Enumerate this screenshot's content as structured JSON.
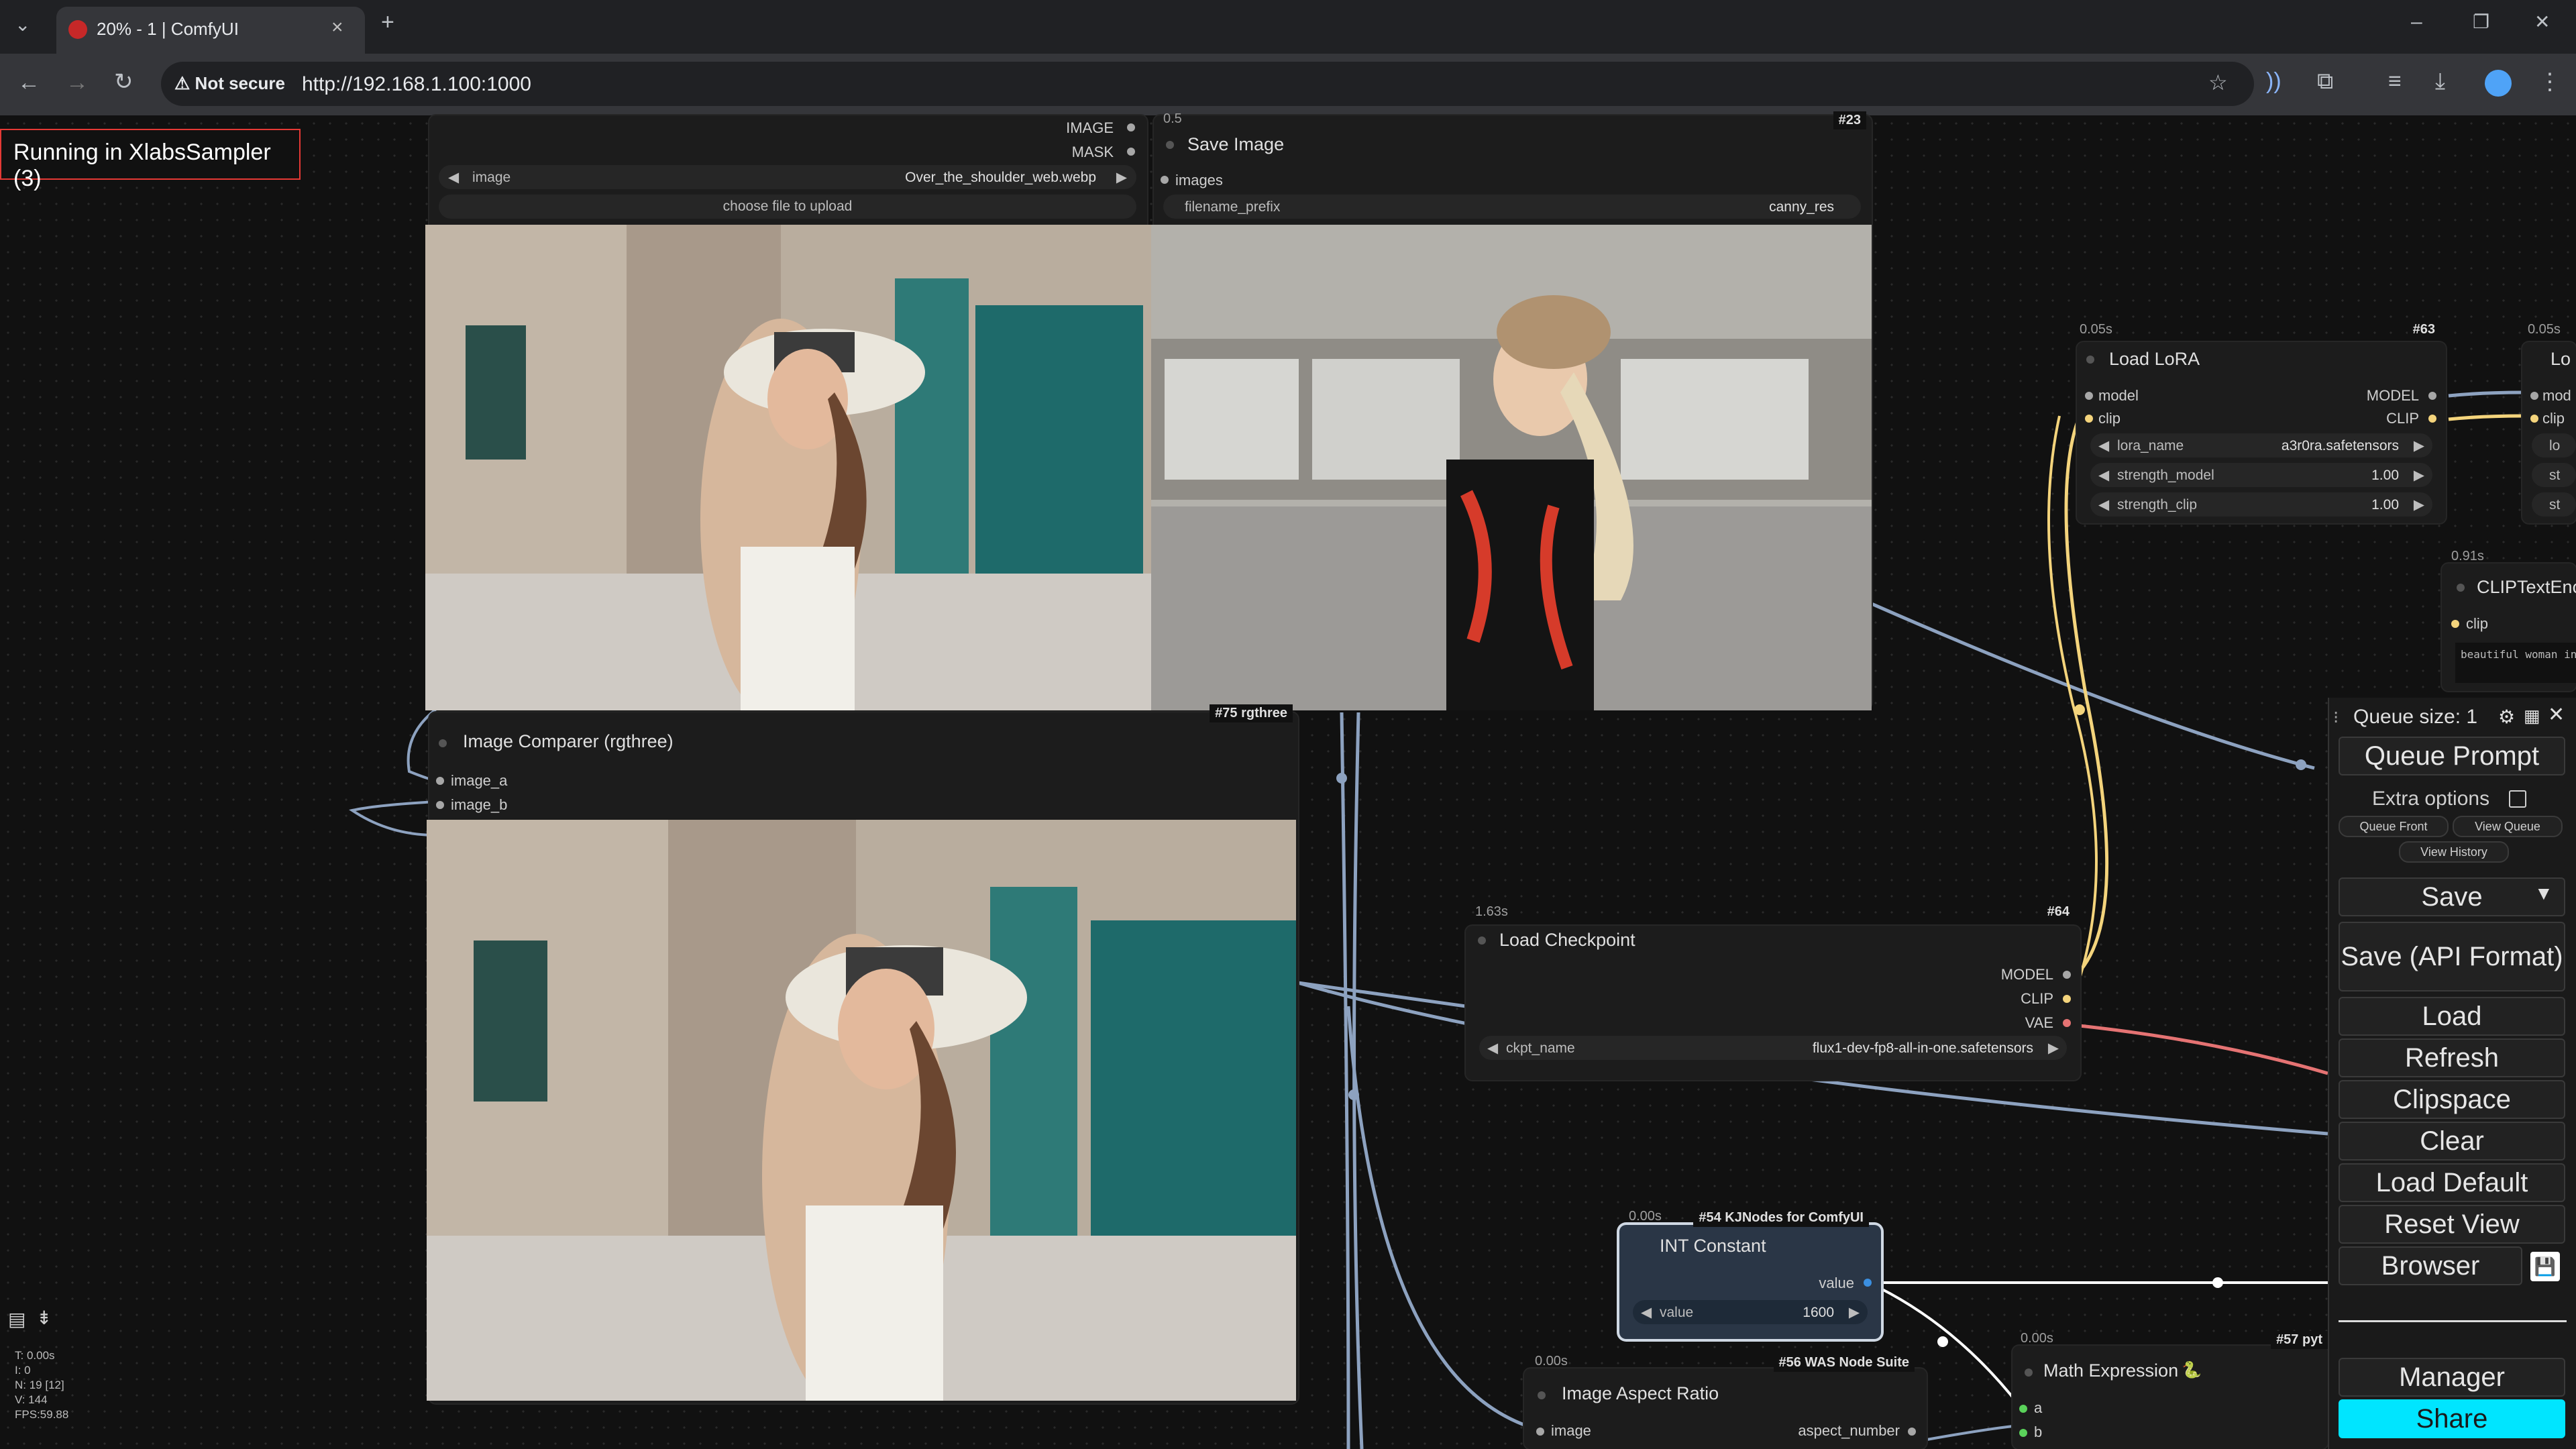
{
  "browser": {
    "tab_title": "20% - 1 | ComfyUI",
    "new_tab": "+",
    "security_label": "Not secure",
    "url": "http://192.168.1.100:1000",
    "window_controls": [
      "–",
      "❐",
      "✕"
    ]
  },
  "status": {
    "text": "Running in XlabsSampler (3)"
  },
  "load_image_node": {
    "outputs": [
      "IMAGE",
      "MASK"
    ],
    "widget_label": "image",
    "widget_value": "Over_the_shoulder_web.webp",
    "upload_label": "choose file to upload"
  },
  "save_image_node": {
    "timing": "0.5",
    "badge": "#23",
    "title": "Save Image",
    "input": "images",
    "widget_label": "filename_prefix",
    "widget_value": "canny_res"
  },
  "comparer_node": {
    "badge": "#75 rgthree",
    "title": "Image Comparer (rgthree)",
    "inputs": [
      "image_a",
      "image_b"
    ]
  },
  "lora_node": {
    "timing": "0.05s",
    "badge": "#63",
    "title": "Load LoRA",
    "inputs": [
      "model",
      "clip"
    ],
    "outputs": [
      "MODEL",
      "CLIP"
    ],
    "widgets": [
      {
        "label": "lora_name",
        "value": "a3r0ra.safetensors"
      },
      {
        "label": "strength_model",
        "value": "1.00"
      },
      {
        "label": "strength_clip",
        "value": "1.00"
      }
    ]
  },
  "partial_lora_node": {
    "timing": "0.05s",
    "title": "Lo",
    "inputs": [
      "mod",
      "clip"
    ],
    "widgets": [
      "lo",
      "st",
      "st"
    ]
  },
  "clip_node": {
    "timing": "0.91s",
    "title": "CLIPTextEnc",
    "input": "clip",
    "text": "beautiful woman in"
  },
  "checkpoint_node": {
    "timing": "1.63s",
    "badge": "#64",
    "title": "Load Checkpoint",
    "outputs": [
      "MODEL",
      "CLIP",
      "VAE"
    ],
    "widget_label": "ckpt_name",
    "widget_value": "flux1-dev-fp8-all-in-one.safetensors"
  },
  "int_node": {
    "timing": "0.00s",
    "badge": "#54 KJNodes for ComfyUI",
    "title": "INT Constant",
    "output": "value",
    "widget_label": "value",
    "widget_value": "1600"
  },
  "aspect_node": {
    "timing": "0.00s",
    "badge": "#56 WAS Node Suite",
    "title": "Image Aspect Ratio",
    "input": "image",
    "output": "aspect_number"
  },
  "math_node": {
    "timing": "0.00s",
    "badge": "#57 pyt",
    "title": "Math Expression",
    "inputs": [
      "a",
      "b"
    ]
  },
  "queue": {
    "size_label": "Queue size: 1",
    "queue_prompt": "Queue Prompt",
    "extra_options": "Extra options",
    "queue_front": "Queue Front",
    "view_queue": "View Queue",
    "view_history": "View History",
    "save": "Save",
    "save_api": "Save (API Format)",
    "load": "Load",
    "refresh": "Refresh",
    "clipspace": "Clipspace",
    "clear": "Clear",
    "load_default": "Load Default",
    "reset_view": "Reset View",
    "browser": "Browser",
    "manager": "Manager",
    "share": "Share"
  },
  "stats": [
    "T: 0.00s",
    "I: 0",
    "N: 19 [12]",
    "V: 144",
    "FPS:59.88"
  ],
  "colors": {
    "accent_share": "#00e5ff",
    "status_border": "#e53935",
    "link_clip": "#f4d47c",
    "link_vae": "#e57373",
    "link_image": "#8da2c0"
  },
  "icons": [
    "chevron-down-icon",
    "back-icon",
    "forward-icon",
    "reload-icon",
    "warning-icon",
    "star-icon",
    "extensions-icon",
    "download-icon",
    "menu-icon",
    "gear-icon",
    "close-icon",
    "save-icon"
  ]
}
